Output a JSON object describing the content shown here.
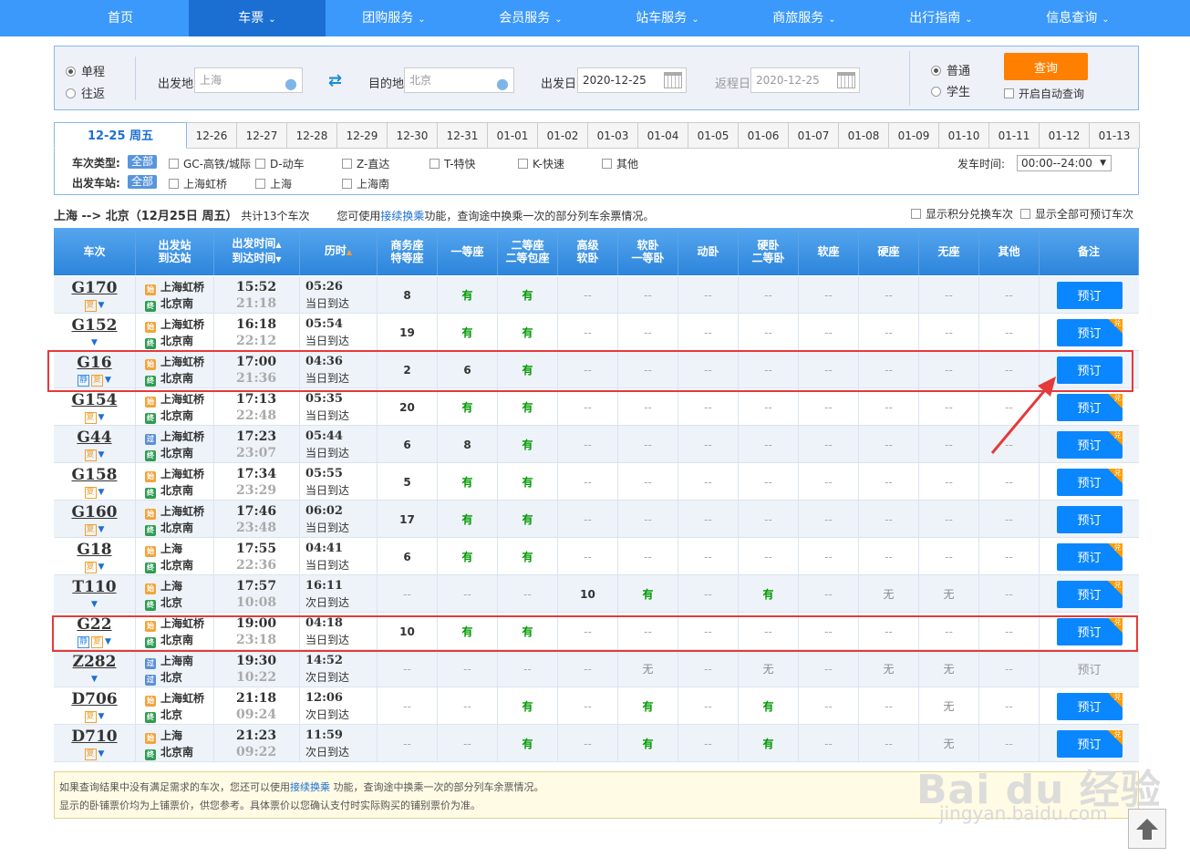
{
  "nav": {
    "items": [
      "首页",
      "车票",
      "团购服务",
      "会员服务",
      "站车服务",
      "商旅服务",
      "出行指南",
      "信息查询"
    ],
    "chev": "⌄"
  },
  "query": {
    "one_way": "单程",
    "round_trip": "往返",
    "from_label": "出发地",
    "from_value": "上海",
    "to_label": "目的地",
    "to_value": "北京",
    "date_label": "出发日",
    "date_value": "2020-12-25",
    "return_label": "返程日",
    "return_value": "2020-12-25",
    "normal": "普通",
    "student": "学生",
    "search_btn": "查询",
    "auto_query": "开启自动查询",
    "swap_icon": "swap-icon"
  },
  "dates": {
    "active": "12-25 周五",
    "items": [
      "12-26",
      "12-27",
      "12-28",
      "12-29",
      "12-30",
      "12-31",
      "01-01",
      "01-02",
      "01-03",
      "01-04",
      "01-05",
      "01-06",
      "01-07",
      "01-08",
      "01-09",
      "01-10",
      "01-11",
      "01-12",
      "01-13"
    ]
  },
  "filters": {
    "type_label": "车次类型:",
    "all": "全部",
    "types": [
      "GC-高铁/城际",
      "D-动车",
      "Z-直达",
      "T-特快",
      "K-快速",
      "其他"
    ],
    "station_label": "出发车站:",
    "stations": [
      "上海虹桥",
      "上海",
      "上海南"
    ],
    "time_label": "发车时间:",
    "time_value": "00:00--24:00"
  },
  "summary": {
    "route": "上海 --> 北京（12月25日 周五）",
    "count": "共计13个车次",
    "tip_a": "您可使用",
    "tip_link": "接续换乘",
    "tip_b": "功能，查询途中换乘一次的部分列车余票情况。",
    "opt1": "显示积分兑换车次",
    "opt2": "显示全部可预订车次"
  },
  "headers": {
    "train": "车次",
    "station_a": "出发站",
    "station_b": "到达站",
    "time_a": "出发时间",
    "time_b": "到达时间",
    "duration": "历时",
    "business_a": "商务座",
    "business_b": "特等座",
    "first": "一等座",
    "second_a": "二等座",
    "second_b": "二等包座",
    "hsoft_a": "高级",
    "hsoft_b": "软卧",
    "soft_a": "软卧",
    "soft_b": "一等卧",
    "moving": "动卧",
    "hard_a": "硬卧",
    "hard_b": "二等卧",
    "softseat": "软座",
    "hardseat": "硬座",
    "noseat": "无座",
    "other": "其他",
    "remark": "备注"
  },
  "trains": [
    {
      "no": "G170",
      "tags": [
        "复"
      ],
      "from": "上海虹桥",
      "from_icon": "始",
      "to": "北京南",
      "to_icon": "终",
      "dep": "15:52",
      "arr": "21:18",
      "dur": "05:26",
      "day": "当日到达",
      "seats": [
        "8",
        "有",
        "有",
        "--",
        "--",
        "--",
        "--",
        "--",
        "--",
        "--",
        "--"
      ],
      "book": "预订",
      "dui": false
    },
    {
      "no": "G152",
      "tags": [],
      "from": "上海虹桥",
      "from_icon": "始",
      "to": "北京南",
      "to_icon": "终",
      "dep": "16:18",
      "arr": "22:12",
      "dur": "05:54",
      "day": "当日到达",
      "seats": [
        "19",
        "有",
        "有",
        "--",
        "--",
        "--",
        "--",
        "--",
        "--",
        "--",
        "--"
      ],
      "book": "预订",
      "dui": true
    },
    {
      "no": "G16",
      "tags": [
        "静",
        "复"
      ],
      "from": "上海虹桥",
      "from_icon": "始",
      "to": "北京南",
      "to_icon": "终",
      "dep": "17:00",
      "arr": "21:36",
      "dur": "04:36",
      "day": "当日到达",
      "seats": [
        "2",
        "6",
        "有",
        "--",
        "--",
        "--",
        "--",
        "--",
        "--",
        "--",
        "--"
      ],
      "book": "预订",
      "dui": false
    },
    {
      "no": "G154",
      "tags": [
        "复"
      ],
      "from": "上海虹桥",
      "from_icon": "始",
      "to": "北京南",
      "to_icon": "终",
      "dep": "17:13",
      "arr": "22:48",
      "dur": "05:35",
      "day": "当日到达",
      "seats": [
        "20",
        "有",
        "有",
        "--",
        "--",
        "--",
        "--",
        "--",
        "--",
        "--",
        "--"
      ],
      "book": "预订",
      "dui": true
    },
    {
      "no": "G44",
      "tags": [
        "复"
      ],
      "from": "上海虹桥",
      "from_icon": "过",
      "to": "北京南",
      "to_icon": "终",
      "dep": "17:23",
      "arr": "23:07",
      "dur": "05:44",
      "day": "当日到达",
      "seats": [
        "6",
        "8",
        "有",
        "--",
        "--",
        "--",
        "--",
        "--",
        "--",
        "--",
        "--"
      ],
      "book": "预订",
      "dui": true
    },
    {
      "no": "G158",
      "tags": [
        "复"
      ],
      "from": "上海虹桥",
      "from_icon": "始",
      "to": "北京南",
      "to_icon": "终",
      "dep": "17:34",
      "arr": "23:29",
      "dur": "05:55",
      "day": "当日到达",
      "seats": [
        "5",
        "有",
        "有",
        "--",
        "--",
        "--",
        "--",
        "--",
        "--",
        "--",
        "--"
      ],
      "book": "预订",
      "dui": true
    },
    {
      "no": "G160",
      "tags": [
        "复"
      ],
      "from": "上海虹桥",
      "from_icon": "始",
      "to": "北京南",
      "to_icon": "终",
      "dep": "17:46",
      "arr": "23:48",
      "dur": "06:02",
      "day": "当日到达",
      "seats": [
        "17",
        "有",
        "有",
        "--",
        "--",
        "--",
        "--",
        "--",
        "--",
        "--",
        "--"
      ],
      "book": "预订",
      "dui": false
    },
    {
      "no": "G18",
      "tags": [
        "复"
      ],
      "from": "上海",
      "from_icon": "始",
      "to": "北京南",
      "to_icon": "终",
      "dep": "17:55",
      "arr": "22:36",
      "dur": "04:41",
      "day": "当日到达",
      "seats": [
        "6",
        "有",
        "有",
        "--",
        "--",
        "--",
        "--",
        "--",
        "--",
        "--",
        "--"
      ],
      "book": "预订",
      "dui": true
    },
    {
      "no": "T110",
      "tags": [],
      "from": "上海",
      "from_icon": "始",
      "to": "北京",
      "to_icon": "终",
      "dep": "17:57",
      "arr": "10:08",
      "dur": "16:11",
      "day": "次日到达",
      "seats": [
        "--",
        "--",
        "--",
        "10",
        "有",
        "--",
        "有",
        "--",
        "无",
        "无",
        "--"
      ],
      "book": "预订",
      "dui": true
    },
    {
      "no": "G22",
      "tags": [
        "静",
        "复"
      ],
      "from": "上海虹桥",
      "from_icon": "始",
      "to": "北京南",
      "to_icon": "终",
      "dep": "19:00",
      "arr": "23:18",
      "dur": "04:18",
      "day": "当日到达",
      "seats": [
        "10",
        "有",
        "有",
        "--",
        "--",
        "--",
        "--",
        "--",
        "--",
        "--",
        "--"
      ],
      "book": "预订",
      "dui": true
    },
    {
      "no": "Z282",
      "tags": [],
      "from": "上海南",
      "from_icon": "过",
      "to": "北京",
      "to_icon": "过",
      "dep": "19:30",
      "arr": "10:22",
      "dur": "14:52",
      "day": "次日到达",
      "seats": [
        "--",
        "--",
        "--",
        "--",
        "无",
        "--",
        "无",
        "--",
        "无",
        "无",
        "--"
      ],
      "book": "预订",
      "dui": false,
      "disabled": true
    },
    {
      "no": "D706",
      "tags": [
        "复"
      ],
      "from": "上海虹桥",
      "from_icon": "始",
      "to": "北京",
      "to_icon": "终",
      "dep": "21:18",
      "arr": "09:24",
      "dur": "12:06",
      "day": "次日到达",
      "seats": [
        "--",
        "--",
        "有",
        "--",
        "有",
        "--",
        "有",
        "--",
        "--",
        "无",
        "--"
      ],
      "book": "预订",
      "dui": true
    },
    {
      "no": "D710",
      "tags": [
        "复"
      ],
      "from": "上海",
      "from_icon": "始",
      "to": "北京南",
      "to_icon": "终",
      "dep": "21:23",
      "arr": "09:22",
      "dur": "11:59",
      "day": "次日到达",
      "seats": [
        "--",
        "--",
        "有",
        "--",
        "有",
        "--",
        "有",
        "--",
        "--",
        "无",
        "--"
      ],
      "book": "预订",
      "dui": true
    }
  ],
  "note": {
    "line1_a": "如果查询结果中没有满足需求的车次，您还可以使用",
    "line1_link": "接续换乘",
    "line1_b": " 功能，查询途中换乘一次的部分列车余票情况。",
    "line2": "显示的卧铺票价均为上铺票价，供您参考。具体票价以您确认支付时实际购买的铺别票价为准。"
  },
  "dui_label": "兑",
  "watermark": {
    "a": "Bai du 经验",
    "b": "jingyan.baidu.com"
  }
}
